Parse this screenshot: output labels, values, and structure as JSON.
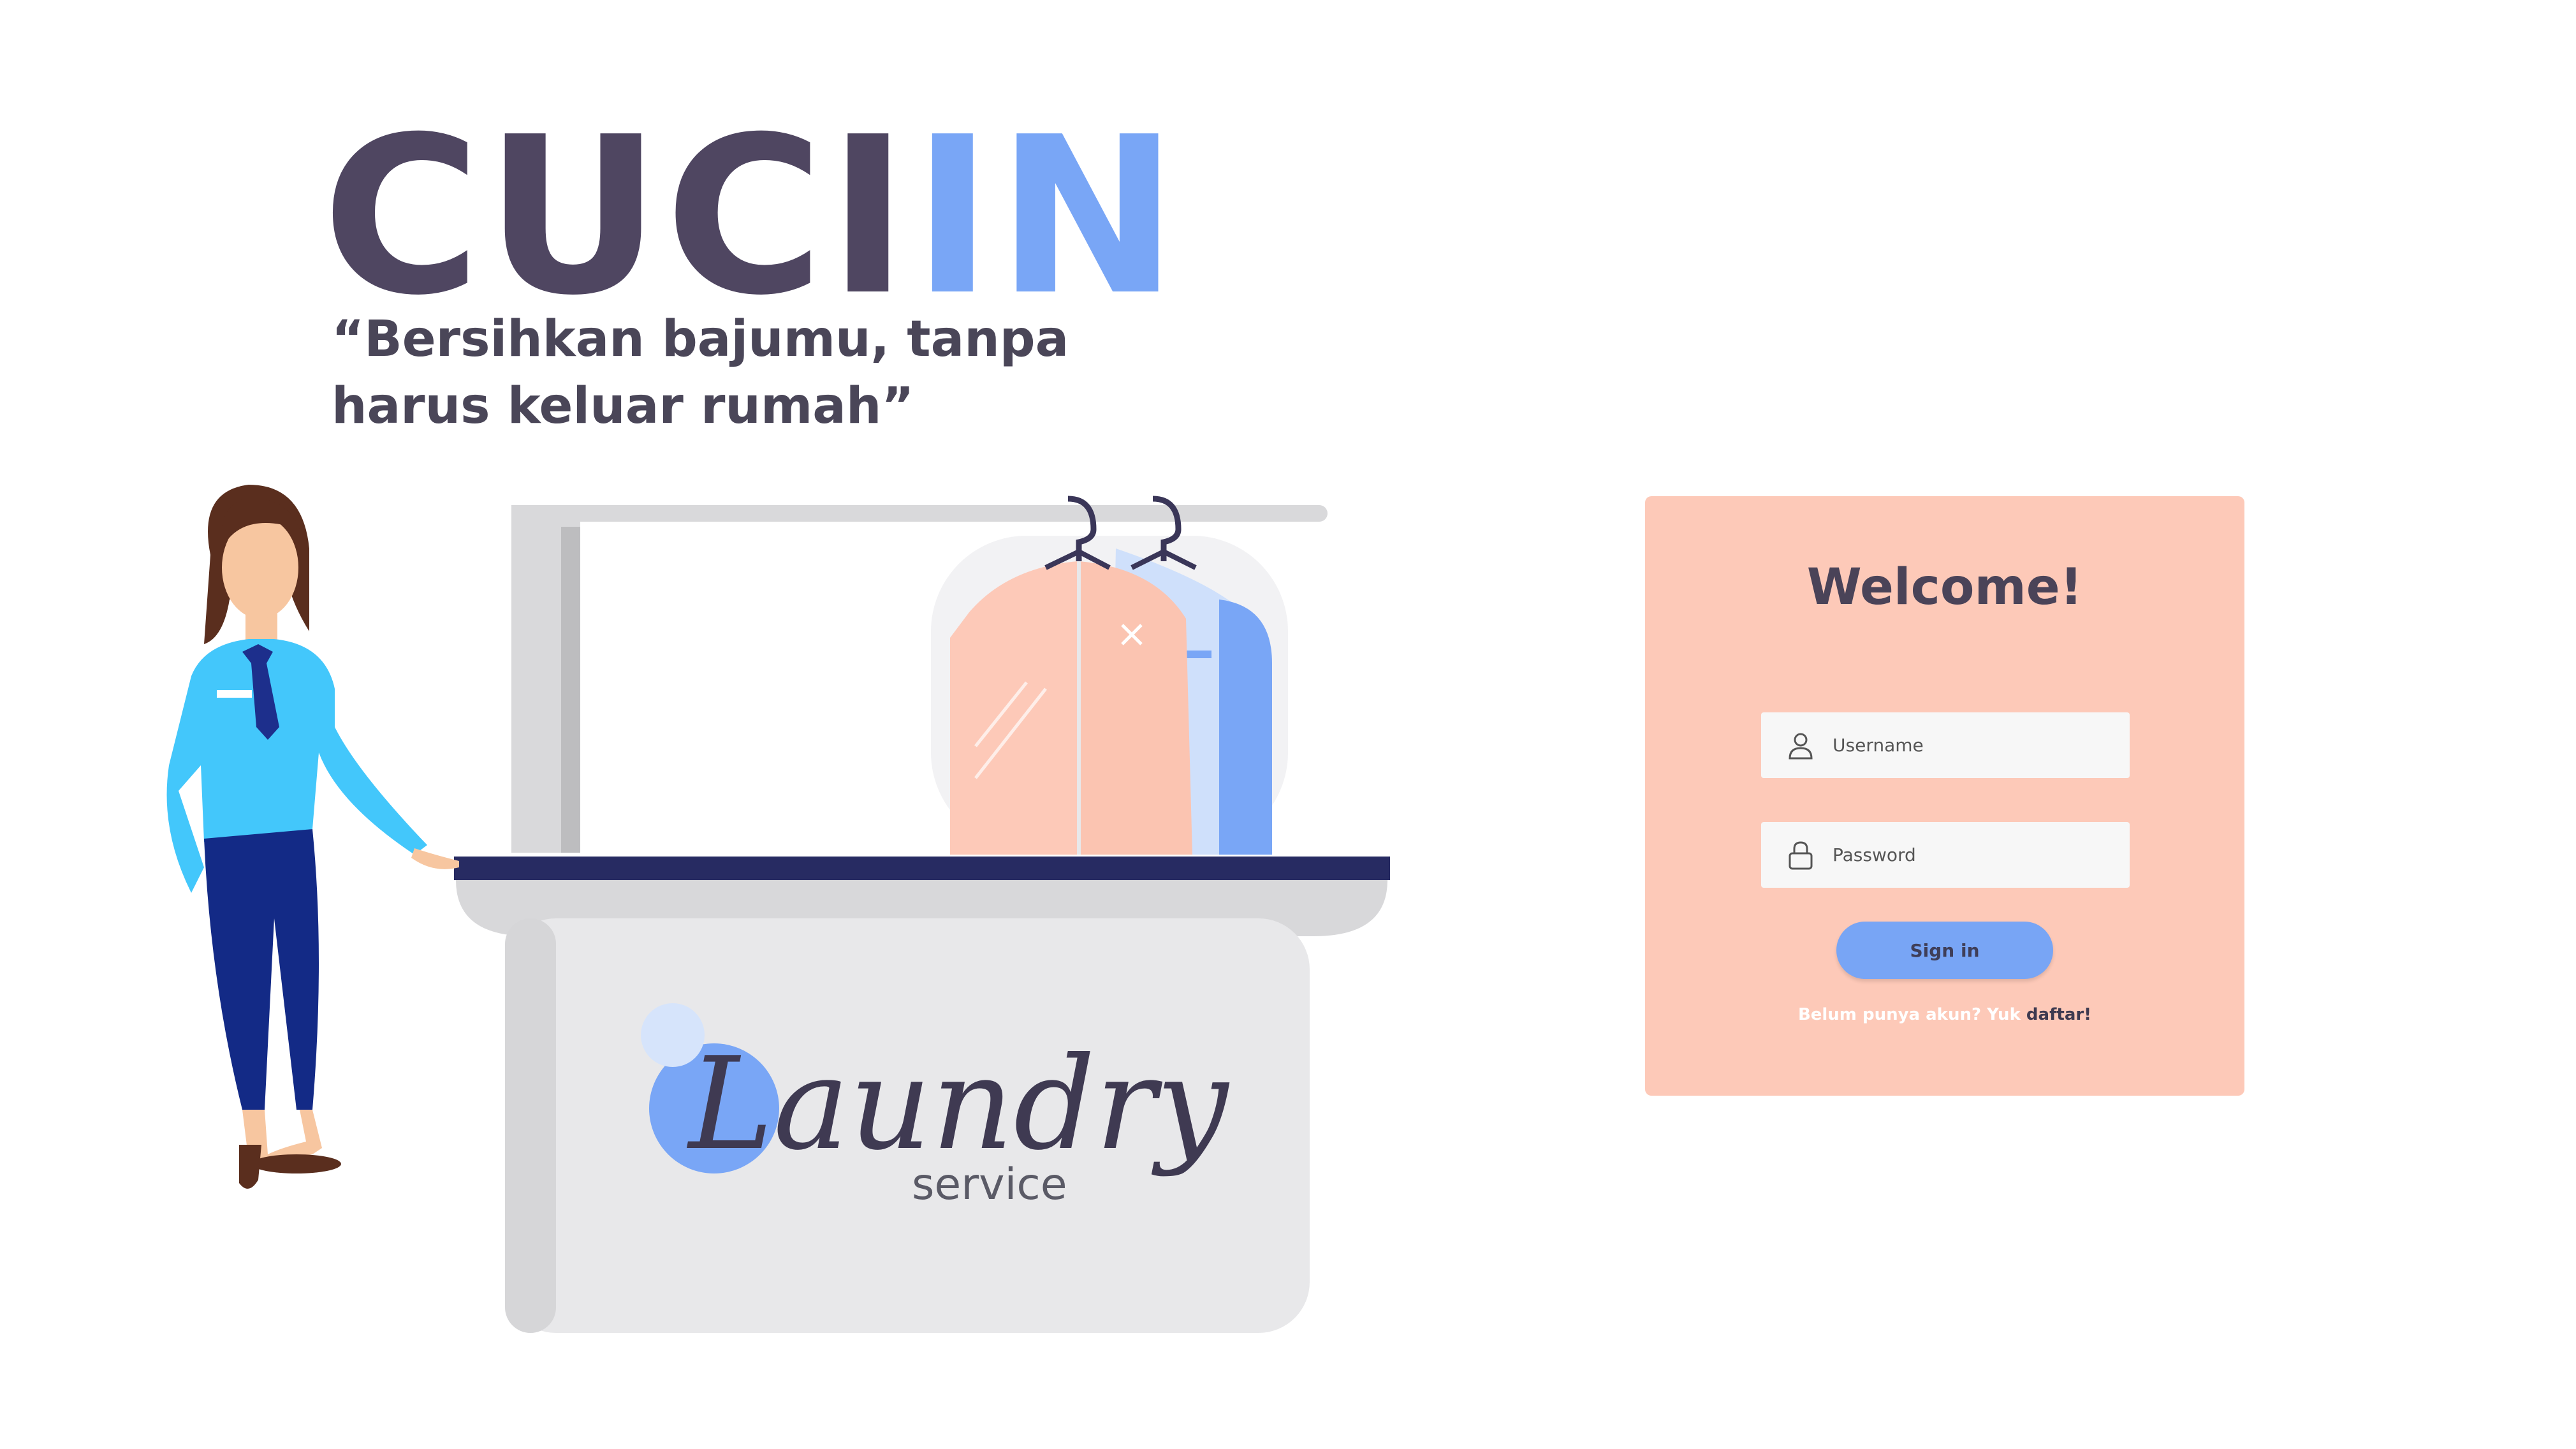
{
  "brand": {
    "part1": "CUCI",
    "part2": "IN"
  },
  "tagline": {
    "line1": "“Bersihkan bajumu, tanpa",
    "line2": "harus keluar rumah”"
  },
  "illustration": {
    "logo_script": "Laundry",
    "logo_sub": "service"
  },
  "login": {
    "title": "Welcome!",
    "username_placeholder": "Username",
    "password_placeholder": "Password",
    "signin_label": "Sign in",
    "signup_prompt": "Belum punya akun? Yuk ",
    "signup_link": "daftar!"
  },
  "icons": {
    "username": "user-icon",
    "password": "lock-icon"
  },
  "colors": {
    "brand_dark": "#4f4661",
    "brand_accent": "#79a6f6",
    "card_bg": "#fdc9b8",
    "button": "#78a5f5"
  }
}
